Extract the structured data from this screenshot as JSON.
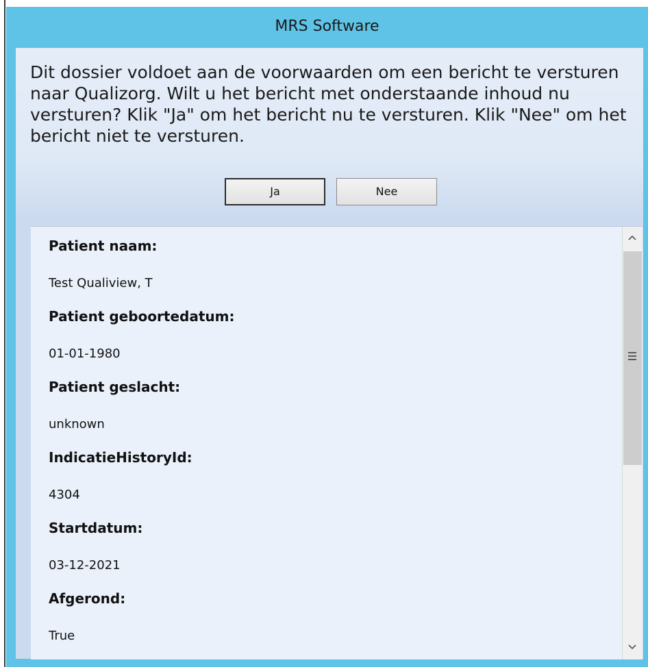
{
  "window": {
    "title": "MRS Software"
  },
  "dialog": {
    "message": "Dit dossier voldoet aan de voorwaarden om een bericht te versturen naar Qualizorg. Wilt u het bericht met onderstaande inhoud nu versturen? Klik \"Ja\" om het bericht nu te versturen. Klik \"Nee\" om het bericht niet te versturen.",
    "yes_label": "Ja",
    "no_label": "Nee"
  },
  "details": {
    "fields": [
      {
        "label": "Patient naam:",
        "value": "Test Qualiview, T"
      },
      {
        "label": "Patient geboortedatum:",
        "value": "01-01-1980"
      },
      {
        "label": "Patient geslacht:",
        "value": "unknown"
      },
      {
        "label": "IndicatieHistoryId:",
        "value": "4304"
      },
      {
        "label": "Startdatum:",
        "value": "03-12-2021"
      },
      {
        "label": "Afgerond:",
        "value": "True"
      }
    ]
  },
  "colors": {
    "titlebar": "#5ec3e6",
    "client_top": "#e5edf8",
    "client_bottom": "#cbdaef",
    "details_bg": "#eaf1fb"
  }
}
